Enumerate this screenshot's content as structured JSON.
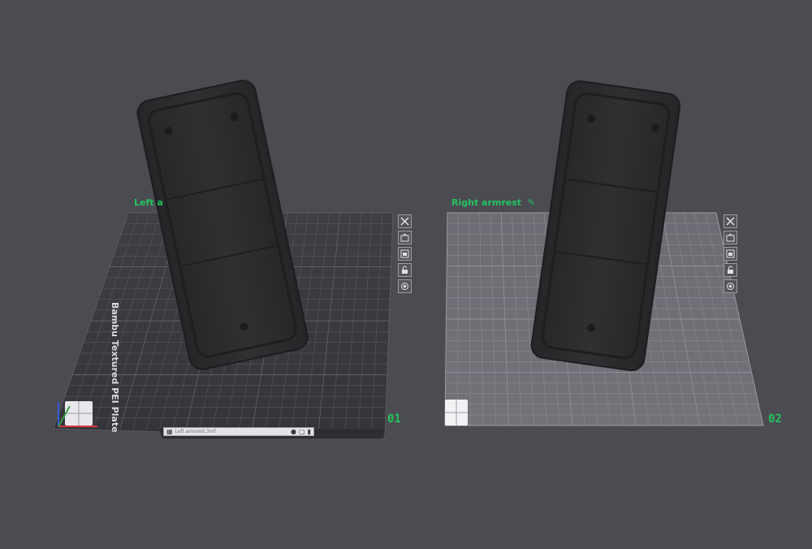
{
  "colors": {
    "background": "#4b4b52",
    "label_green": "#22c55e",
    "model_dark": "#2a2a2c"
  },
  "plates": [
    {
      "label": "Left a",
      "number": "01",
      "plate_type": "Bambu Textured PEI Plate",
      "style": "dark",
      "tools": [
        "close-icon",
        "auto-orient-icon",
        "arrange-icon",
        "lock-icon",
        "settings-icon"
      ],
      "toolbar": {
        "filename": "Left armrest.3mf"
      }
    },
    {
      "label": "Right armrest",
      "number": "02",
      "style": "light",
      "tools": [
        "close-icon",
        "auto-orient-icon",
        "arrange-icon",
        "lock-icon",
        "settings-icon"
      ]
    }
  ]
}
